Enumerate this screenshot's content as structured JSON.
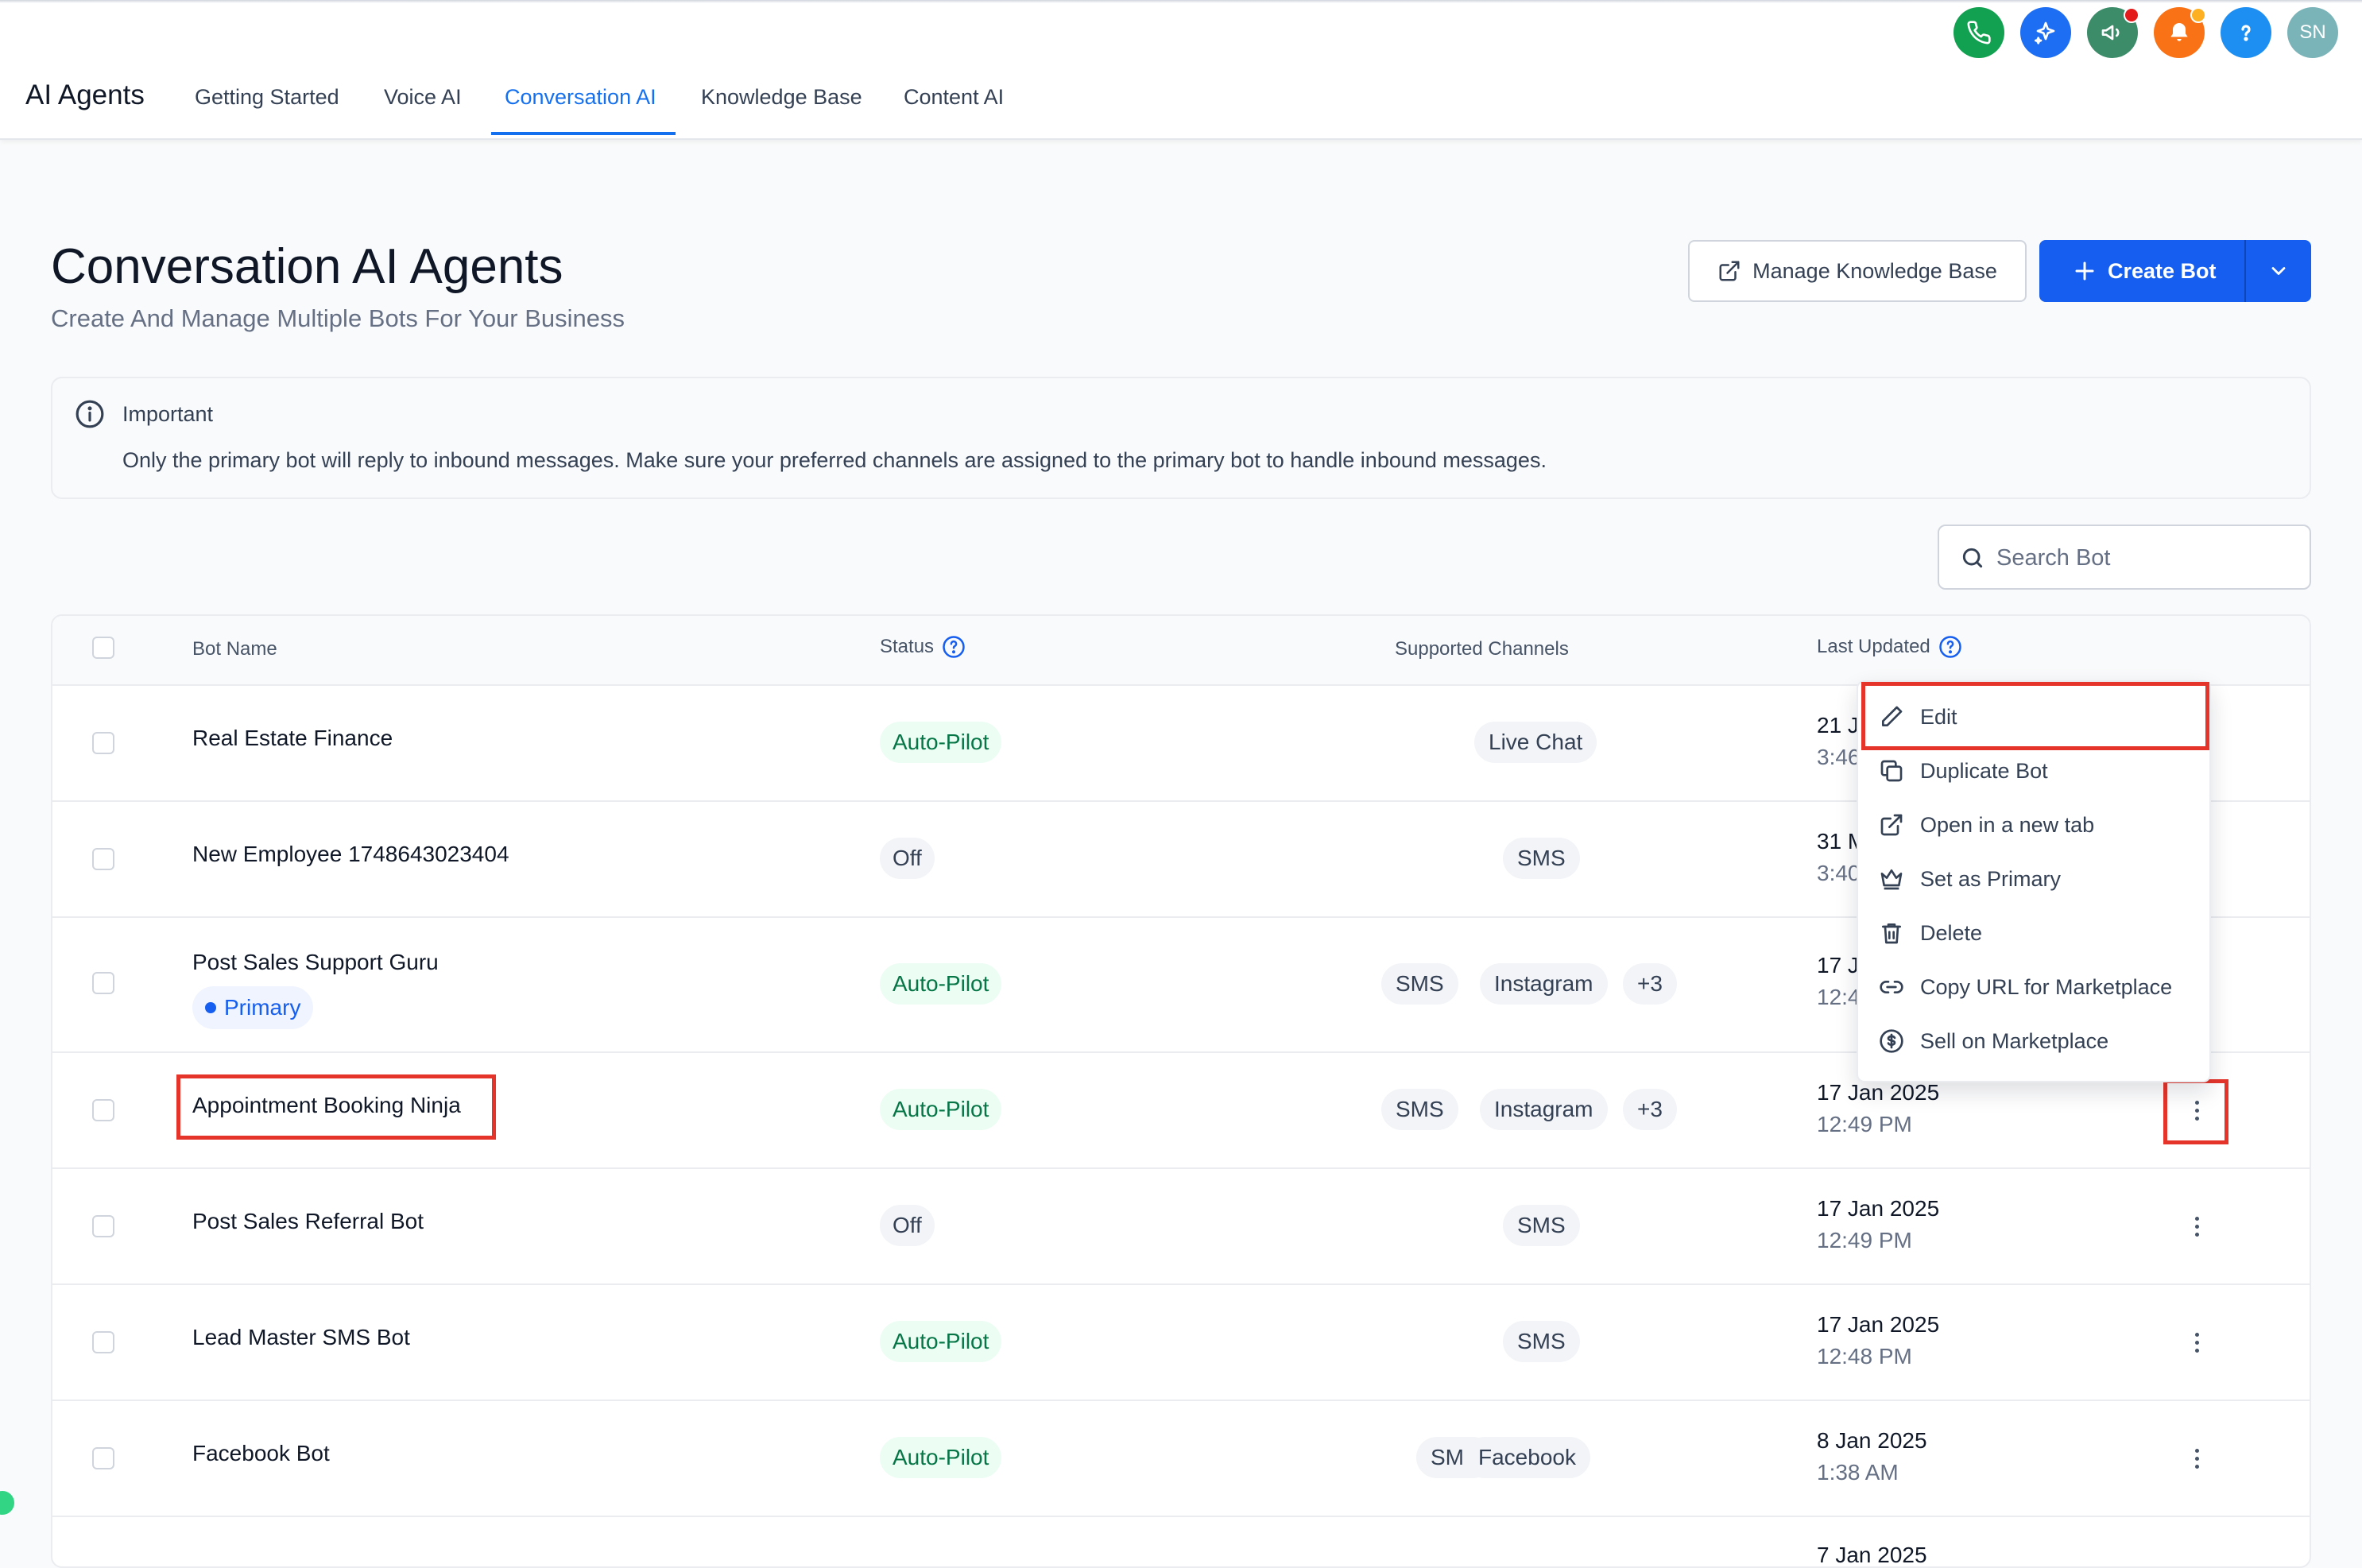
{
  "header": {
    "app_title": "AI Agents",
    "tabs": [
      {
        "label": "Getting Started",
        "active": false
      },
      {
        "label": "Voice AI",
        "active": false
      },
      {
        "label": "Conversation AI",
        "active": true
      },
      {
        "label": "Knowledge Base",
        "active": false
      },
      {
        "label": "Content AI",
        "active": false
      }
    ],
    "top_icons": [
      {
        "name": "phone-icon",
        "color": "#12a150"
      },
      {
        "name": "sparkle-icon",
        "color": "#1d6ef2"
      },
      {
        "name": "megaphone-icon",
        "color": "#3c8c6a"
      },
      {
        "name": "bell-icon",
        "color": "#f97316"
      },
      {
        "name": "help-icon",
        "color": "#1d8ef2"
      }
    ],
    "avatar_initials": "SN"
  },
  "page": {
    "title": "Conversation AI Agents",
    "subtitle": "Create And Manage Multiple Bots For Your Business",
    "manage_kb_label": "Manage Knowledge Base",
    "create_bot_label": "Create Bot"
  },
  "alert": {
    "title": "Important",
    "text": "Only the primary bot will reply to inbound messages. Make sure your preferred channels are assigned to the primary bot to handle inbound messages."
  },
  "search": {
    "placeholder": "Search Bot"
  },
  "table": {
    "headers": {
      "bot_name": "Bot Name",
      "status": "Status",
      "channels": "Supported Channels",
      "last_updated": "Last Updated"
    },
    "rows": [
      {
        "name": "Real Estate Finance",
        "status": "Auto-Pilot",
        "channels": [
          "Live Chat"
        ],
        "date": "21 J",
        "time": "3:46"
      },
      {
        "name": "New Employee 1748643023404",
        "status": "Off",
        "channels": [
          "SMS"
        ],
        "date": "31 M",
        "time": "3:40"
      },
      {
        "name": "Post Sales Support Guru",
        "badge": "Primary",
        "status": "Auto-Pilot",
        "channels": [
          "SMS",
          "Instagram",
          "+3"
        ],
        "date": "17 J",
        "time": "12:4"
      },
      {
        "name": "Appointment Booking Ninja",
        "status": "Auto-Pilot",
        "channels": [
          "SMS",
          "Instagram",
          "+3"
        ],
        "date": "17 Jan 2025",
        "time": "12:49 PM"
      },
      {
        "name": "Post Sales Referral Bot",
        "status": "Off",
        "channels": [
          "SMS"
        ],
        "date": "17 Jan 2025",
        "time": "12:49 PM"
      },
      {
        "name": "Lead Master SMS Bot",
        "status": "Auto-Pilot",
        "channels": [
          "SMS"
        ],
        "date": "17 Jan 2025",
        "time": "12:48 PM"
      },
      {
        "name": "Facebook Bot",
        "status": "Auto-Pilot",
        "channels": [
          "SMS",
          "Facebook"
        ],
        "date": "8 Jan 2025",
        "time": "1:38 AM"
      },
      {
        "date": "7 Jan 2025"
      }
    ]
  },
  "context_menu": {
    "items": [
      {
        "label": "Edit",
        "icon": "pencil-icon"
      },
      {
        "label": "Duplicate Bot",
        "icon": "copy-icon"
      },
      {
        "label": "Open in a new tab",
        "icon": "external-link-icon"
      },
      {
        "label": "Set as Primary",
        "icon": "crown-icon"
      },
      {
        "label": "Delete",
        "icon": "trash-icon"
      },
      {
        "label": "Copy URL for Marketplace",
        "icon": "link-icon"
      },
      {
        "label": "Sell on Marketplace",
        "icon": "dollar-circle-icon"
      }
    ]
  },
  "colors": {
    "accent": "#155eef",
    "active_tab": "#1570ef",
    "autopilot_bg": "#ecfdf3",
    "autopilot_text": "#067647",
    "highlight": "#e5352b"
  }
}
